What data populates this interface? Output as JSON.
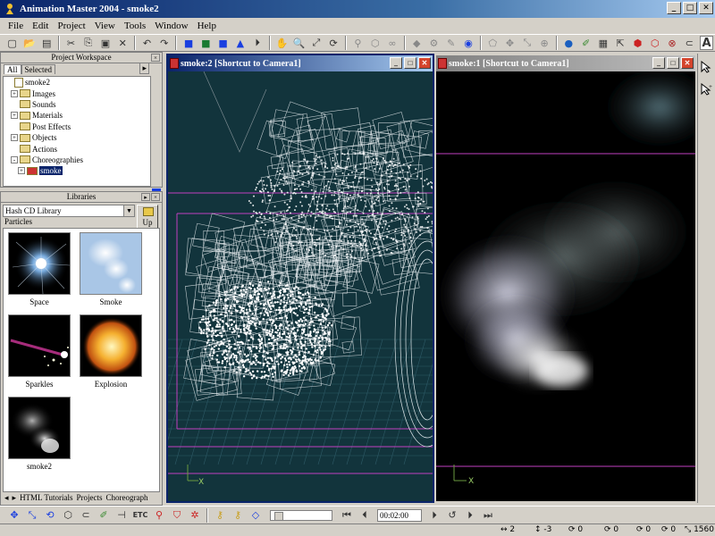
{
  "window": {
    "title": "Animation Master 2004 - smoke2"
  },
  "menu": [
    "File",
    "Edit",
    "Project",
    "View",
    "Tools",
    "Window",
    "Help"
  ],
  "toolbar": {
    "icons": [
      "new-icon",
      "open-icon",
      "save-icon",
      "cut-icon",
      "copy-icon",
      "paste-icon",
      "delete-icon",
      "undo-icon",
      "redo-icon",
      "render-icon",
      "render-to-file-icon",
      "render-lock-icon",
      "hand-icon",
      "zoom-icon",
      "fit-icon",
      "turn-icon",
      "bone-icon",
      "lock-icon",
      "text-icon"
    ],
    "text_label": "A"
  },
  "project_workspace": {
    "title": "Project Workspace",
    "tabs": [
      "All",
      "Selected"
    ],
    "tree": [
      {
        "label": "smoke2",
        "expand": "",
        "sel": false
      },
      {
        "label": "Images",
        "expand": "+",
        "sel": false
      },
      {
        "label": "Sounds",
        "expand": "",
        "sel": false
      },
      {
        "label": "Materials",
        "expand": "+",
        "sel": false
      },
      {
        "label": "Post Effects",
        "expand": "",
        "sel": false
      },
      {
        "label": "Objects",
        "expand": "+",
        "sel": false
      },
      {
        "label": "Actions",
        "expand": "",
        "sel": false
      },
      {
        "label": "Choreographies",
        "expand": "-",
        "sel": false
      },
      {
        "label": "smoke",
        "expand": "+",
        "sel": true
      }
    ]
  },
  "libraries": {
    "title": "Libraries",
    "library_select": "Hash CD Library",
    "up_label": "Up",
    "category": "Particles",
    "items": [
      {
        "label": "Space"
      },
      {
        "label": "Smoke"
      },
      {
        "label": "Sparkles"
      },
      {
        "label": "Explosion"
      },
      {
        "label": "smoke2"
      }
    ],
    "tabs": [
      "HTML Tutorials",
      "Projects",
      "Choreograph"
    ]
  },
  "viewports": [
    {
      "title": "smoke:2 [Shortcut to Camera1]",
      "active": true
    },
    {
      "title": "smoke:1 [Shortcut to Camera1]",
      "active": false
    }
  ],
  "axis": {
    "x_label": "X",
    "y_label": "Y"
  },
  "timeline": {
    "etc_label": "ETC",
    "time_value": "00:02:00"
  },
  "status": {
    "items": [
      "2",
      "-3",
      "0",
      "0",
      "0",
      "0",
      "1560"
    ]
  },
  "colors": {
    "title_active": "#0a246a",
    "viewport_bg": "#12343c",
    "selection": "#0a246a",
    "frame_line": "#c040c0"
  }
}
